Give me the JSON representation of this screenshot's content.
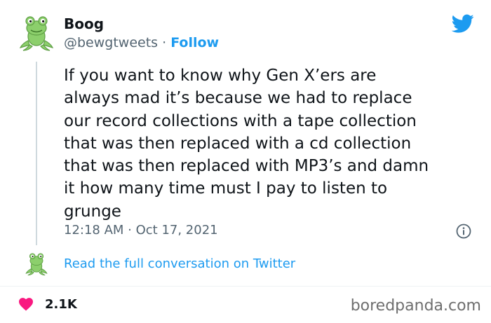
{
  "author": {
    "name": "Boog",
    "handle": "@bewgtweets",
    "separator": "·",
    "follow_label": "Follow",
    "avatar_icon": "frog-avatar-icon"
  },
  "platform_icon": "twitter-bird-icon",
  "tweet": {
    "text": "If you want to know why Gen X’ers are\nalways mad it’s because we had to replace\nour record collections with a tape collection\nthat was then replaced with a cd collection\nthat was then replaced with MP3’s and damn\nit how many time must I pay to listen to\ngrunge",
    "timestamp": "12:18 AM · Oct 17, 2021"
  },
  "thread": {
    "read_link": "Read the full conversation on Twitter"
  },
  "engagement": {
    "likes": "2.1K",
    "like_icon": "heart-icon"
  },
  "watermark": "boredpanda.com",
  "colors": {
    "accent": "#1d9bf0",
    "heart": "#f91880",
    "secondary_text": "#536471",
    "frog": "#8ccf6c"
  }
}
